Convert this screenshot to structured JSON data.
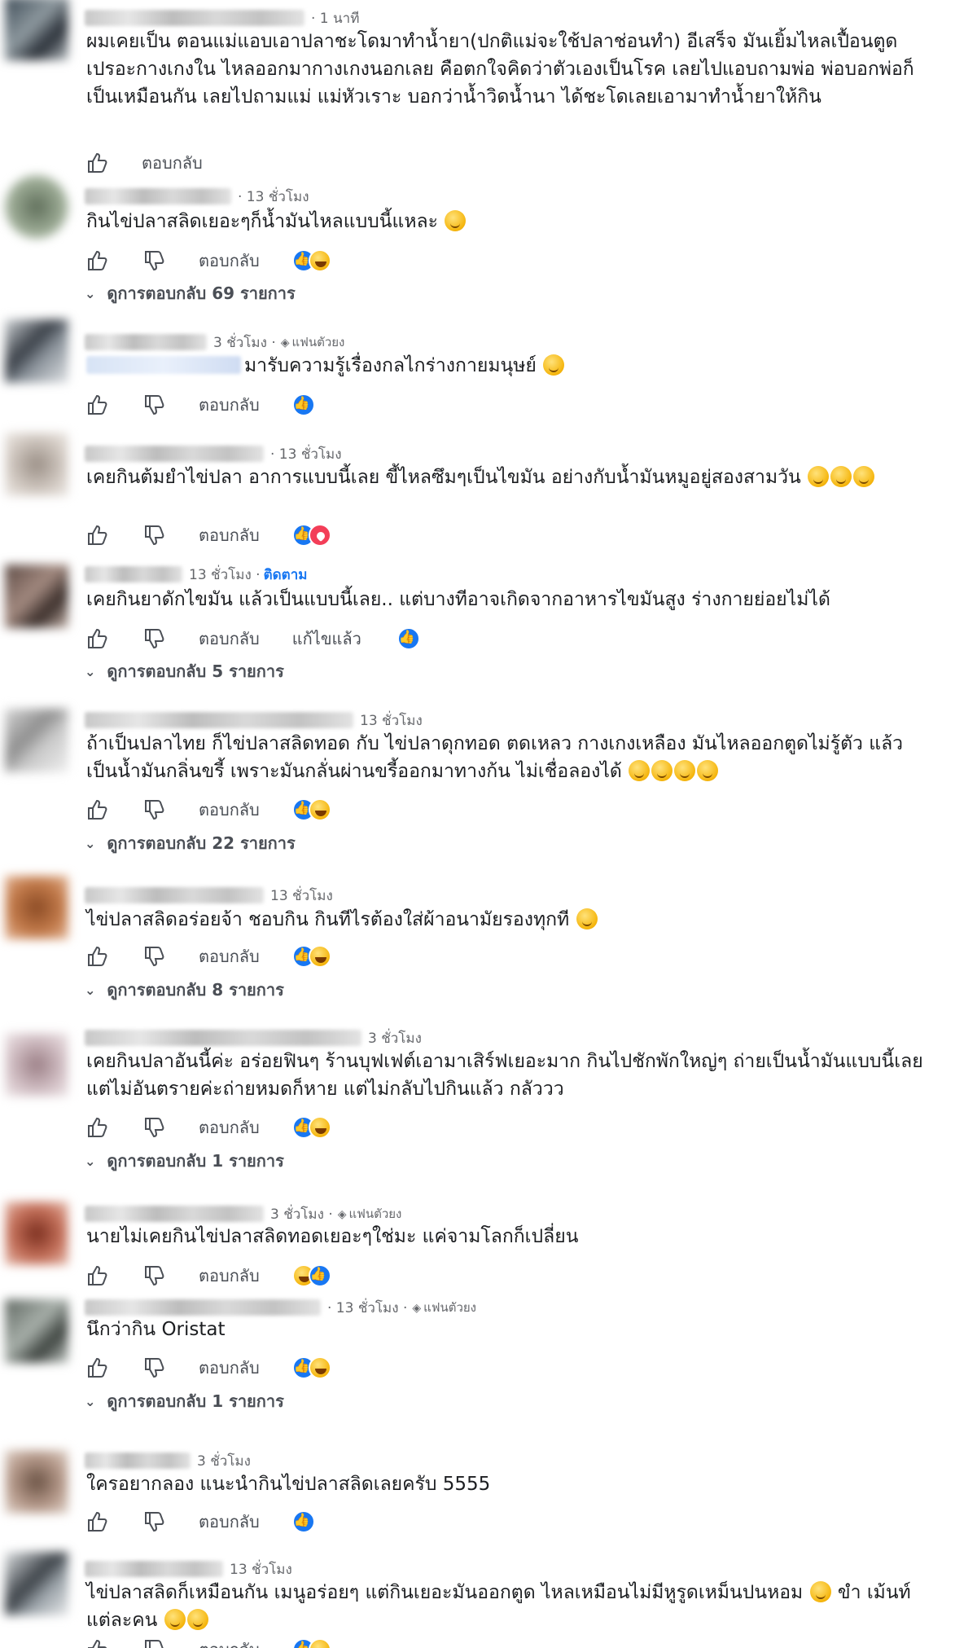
{
  "ui": {
    "reply_label": "ตอบกลับ",
    "edited_label": "แก้ไขแล้ว",
    "follow_label": "ติดตาม",
    "fan_badge_label": "แฟนตัวยง"
  },
  "comments": [
    {
      "time": "· 1 นาที",
      "text": "ผมเคยเป็น ตอนแม่แอบเอาปลาชะโดมาทำน้ำยา(ปกติแม่จะใช้ปลาช่อนทำ) อีเสร็จ มันเยิ้มไหลเปื้อนตูด เปรอะกางเกงใน ไหลออกมากางเกงนอกเลย คือตกใจคิดว่าตัวเองเป็นโรค เลยไปแอบถามพ่อ พ่อบอกพ่อก็เป็นเหมือนกัน เลยไปถามแม่ แม่หัวเราะ บอกว่าน้ำวิดน้ำนา ได้ชะโดเลยเอามาทำน้ำยาให้กิน",
      "replies": ""
    },
    {
      "time": "· 13 ชั่วโมง",
      "text": "กินไข่ปลาสลิดเยอะๆก็น้ำมันไหลแบบนี้แหละ",
      "replies": "ดูการตอบกลับ 69 รายการ"
    },
    {
      "time": "3 ชั่วโมง ·",
      "text": "มารับความรู้เรื่องกลไกร่างกายมนุษย์",
      "replies": ""
    },
    {
      "time": "· 13 ชั่วโมง",
      "text": "เคยกินต้มยำไข่ปลา อาการแบบนี้เลย ขี้ไหลซึมๆเป็นไขมัน อย่างกับน้ำมันหมูอยู่สองสามวัน",
      "replies": ""
    },
    {
      "time": "13 ชั่วโมง ·",
      "text": "เคยกินยาดักไขมัน แล้วเป็นแบบนี้เลย.. แต่บางทีอาจเกิดจากอาหารไขมันสูง ร่างกายย่อยไม่ได้",
      "replies": "ดูการตอบกลับ 5 รายการ"
    },
    {
      "time": "13 ชั่วโมง",
      "text": "ถ้าเป็นปลาไทย ก็ไข่ปลาสลิดทอด กับ ไข่ปลาดุกทอด ตดเหลว กางเกงเหลือง มันไหลออกตูดไม่รู้ตัว แล้วเป็นน้ำมันกลิ่นขรี้ เพราะมันกลั่นผ่านขรี้ออกมาทางก้น ไม่เชื่อลองได้",
      "replies": "ดูการตอบกลับ 22 รายการ"
    },
    {
      "time": "13 ชั่วโมง",
      "text": "ไข่ปลาสลิดอร่อยจ้า ชอบกิน กินทีไรต้องใส่ผ้าอนามัยรองทุกที",
      "replies": "ดูการตอบกลับ 8 รายการ"
    },
    {
      "time": "3 ชั่วโมง",
      "text": "เคยกินปลาอันนี้ค่ะ อร่อยฟินๆ ร้านบุฟเฟต์เอามาเสิร์ฟเยอะมาก กินไปชักพักใหญ่ๆ ถ่ายเป็นน้ำมันแบบนี้เลย แต่ไม่อันตรายค่ะถ่ายหมดก็หาย แต่ไม่กลับไปกินแล้ว กลัววว",
      "replies": "ดูการตอบกลับ 1 รายการ"
    },
    {
      "time": "3 ชั่วโมง ·",
      "text": "นายไม่เคยกินไข่ปลาสลิดทอดเยอะๆใช่มะ แค่จามโลกก็เปลี่ยน",
      "replies": ""
    },
    {
      "time": "· 13 ชั่วโมง ·",
      "text": "นึกว่ากิน Oristat",
      "replies": "ดูการตอบกลับ 1 รายการ"
    },
    {
      "time": "3 ชั่วโมง",
      "text": "ใครอยากลอง แนะนำกินไข่ปลาสลิดเลยครับ 5555",
      "replies": ""
    },
    {
      "time": "13 ชั่วโมง",
      "text": "ไข่ปลาสลิดก็เหมือนกัน เมนูอร่อยๆ แต่กินเยอะมันออกตูด ไหลเหมือนไม่มีหูรูดเหม็นปนหอม",
      "text2": "ขำ",
      "text3": "เม้นท์แต่ละคน",
      "replies": ""
    }
  ]
}
